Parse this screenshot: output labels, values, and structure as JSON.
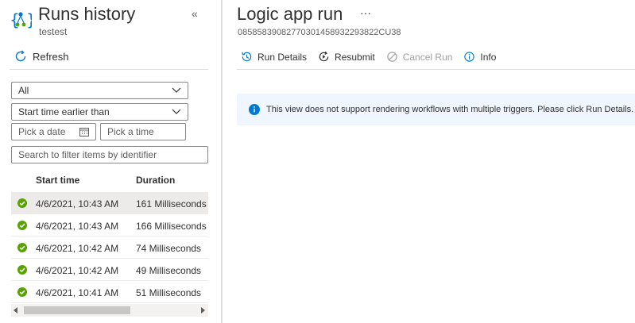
{
  "sidebar": {
    "title": "Runs history",
    "subtitle": "testest",
    "collapse_glyph": "«",
    "refresh_label": "Refresh",
    "status_filter": {
      "selected": "All"
    },
    "time_filter": {
      "selected": "Start time earlier than"
    },
    "date_placeholder": "Pick a date",
    "time_placeholder": "Pick a time",
    "search_placeholder": "Search to filter items by identifier",
    "columns": [
      "Start time",
      "Duration"
    ],
    "runs": [
      {
        "start": "4/6/2021, 10:43 AM",
        "duration": "161 Milliseconds",
        "status": "succeeded"
      },
      {
        "start": "4/6/2021, 10:43 AM",
        "duration": "166 Milliseconds",
        "status": "succeeded"
      },
      {
        "start": "4/6/2021, 10:42 AM",
        "duration": "74 Milliseconds",
        "status": "succeeded"
      },
      {
        "start": "4/6/2021, 10:42 AM",
        "duration": "49 Milliseconds",
        "status": "succeeded"
      },
      {
        "start": "4/6/2021, 10:41 AM",
        "duration": "51 Milliseconds",
        "status": "succeeded"
      }
    ],
    "selected_run_index": 0
  },
  "main": {
    "title": "Logic app run",
    "more_glyph": "···",
    "run_id": "08585839082770301458932293822CU38",
    "toolbar": {
      "run_details": "Run Details",
      "resubmit": "Resubmit",
      "cancel_run": "Cancel Run",
      "info": "Info"
    },
    "notice": "This view does not support rendering workflows with multiple triggers. Please click Run Details."
  },
  "colors": {
    "accent": "#0078d4",
    "success": "#57a300",
    "info_bg": "#f0f6ff",
    "disabled": "#a19f9d"
  },
  "icons": {
    "app": "logic-app-icon",
    "refresh": "refresh-icon",
    "run_details": "history-icon",
    "resubmit": "resubmit-icon",
    "cancel": "cancel-icon",
    "info": "info-icon",
    "status": "success-check-icon",
    "calendar": "calendar-icon"
  }
}
